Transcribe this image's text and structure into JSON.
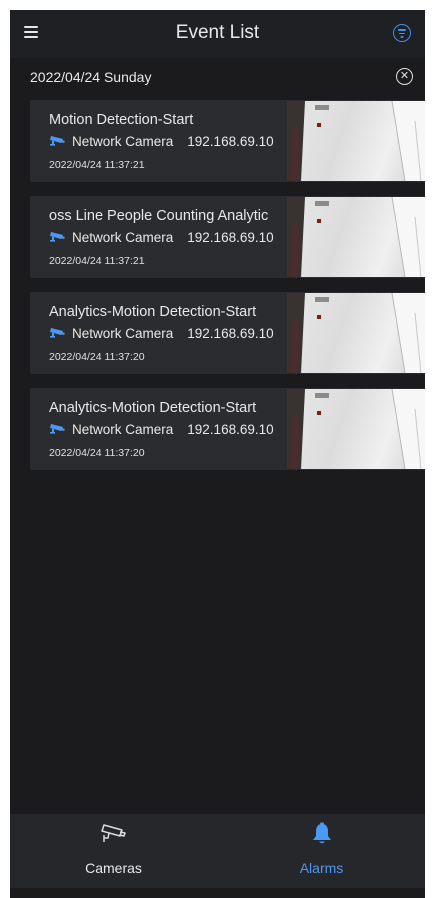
{
  "header": {
    "title": "Event List"
  },
  "date_group": {
    "label": "2022/04/24 Sunday"
  },
  "events": [
    {
      "title": "Motion Detection-Start",
      "camera": "Network Camera",
      "ip": "192.168.69.10",
      "time": "2022/04/24 11:37:21"
    },
    {
      "title": "oss Line People Counting   Analytic",
      "camera": "Network Camera",
      "ip": "192.168.69.10",
      "time": "2022/04/24 11:37:21"
    },
    {
      "title": "Analytics-Motion Detection-Start",
      "camera": "Network Camera",
      "ip": "192.168.69.10",
      "time": "2022/04/24 11:37:20"
    },
    {
      "title": "Analytics-Motion Detection-Start",
      "camera": "Network Camera",
      "ip": "192.168.69.10",
      "time": "2022/04/24 11:37:20"
    }
  ],
  "tabs": [
    {
      "label": "Cameras",
      "icon": "cctv-icon",
      "active": false
    },
    {
      "label": "Alarms",
      "icon": "bell-icon",
      "active": true
    }
  ],
  "colors": {
    "accent": "#3d8ff0",
    "background": "#1b1b1d",
    "card": "#2b2c2f",
    "tabbar": "#26272b"
  }
}
